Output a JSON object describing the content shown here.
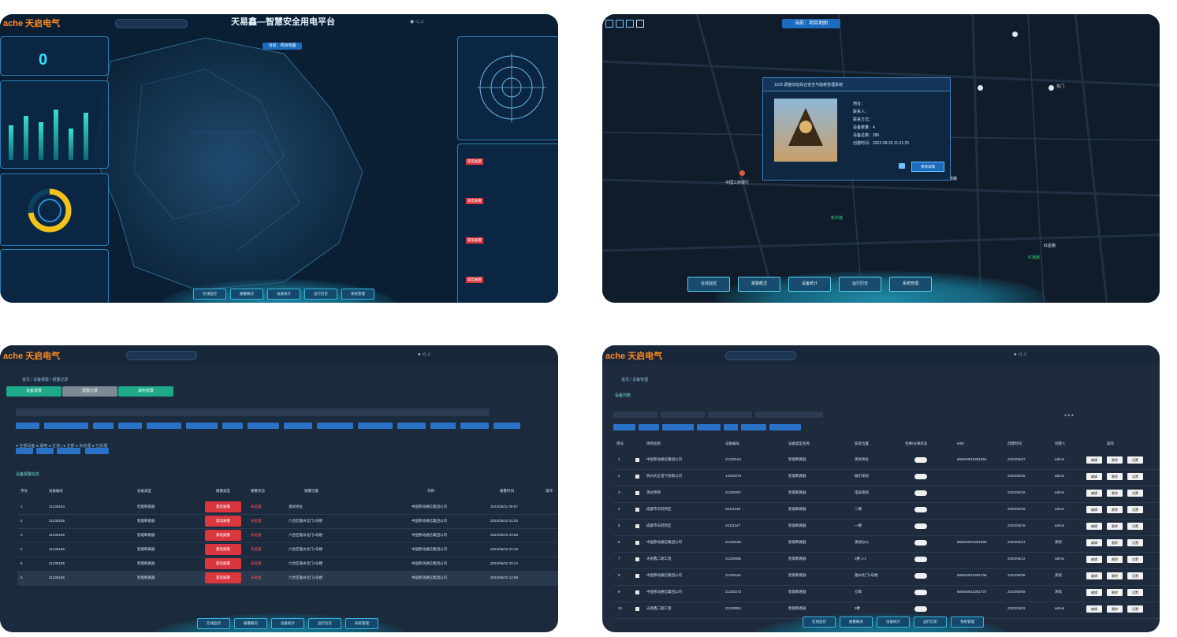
{
  "brand": "ache 天启电气",
  "panel1": {
    "title": "天易鑫—智慧安全用电平台",
    "current_tag": "当前：项目地图",
    "stat_value": "0",
    "alarm_labels": [
      "漏电报警",
      "漏电报警",
      "漏电报警",
      "漏电报警"
    ],
    "nav": [
      "在线监控",
      "报警概况",
      "设备统计",
      "运行历史",
      "系统管理"
    ],
    "bar_heights": [
      0.55,
      0.7,
      0.6,
      0.8,
      0.5,
      0.75
    ]
  },
  "panel2": {
    "current_tag": "当前：项目地图",
    "popup_title": "1103 调度旧址综合安全与能耗管理系统",
    "popup_lines": [
      "地址：",
      "联系人：",
      "联系方式：",
      "设备数量：4",
      "设备总数：285",
      "创建时间：2022-08-29 11:01:25"
    ],
    "popup_button": "项目详情",
    "places": [
      "中国工商银行",
      "红星路",
      "红旗路",
      "火车南路",
      "新华路",
      "东门"
    ],
    "nav": [
      "在线监控",
      "报警概况",
      "设备统计",
      "运行历史",
      "系统管理"
    ]
  },
  "panel3": {
    "breadcrumb": "首页 / 设备报警 / 报警记录",
    "tabs": [
      "设备报警",
      "报警记录",
      "漏电报警"
    ],
    "section_title": "设备报警信息",
    "headers": [
      "序号",
      "设备编号",
      "设备类型",
      "报警类型",
      "报警状态",
      "报警位置",
      "项目",
      "报警时间",
      "操作"
    ],
    "rows": [
      {
        "no": "1",
        "code": "21230164",
        "type": "智能断路器",
        "alarm": "漏电报警",
        "status": "未处理",
        "loc": "测试地址",
        "proj": "中国移动通信集团公司",
        "time": "2022/06/11 09:57"
      },
      {
        "no": "2",
        "code": "21230165",
        "type": "智能断路器",
        "alarm": "漏电报警",
        "status": "未处理",
        "loc": "六合区雄州北门1号楼",
        "proj": "中国移动通信集团公司",
        "time": "2022/06/10 21:02"
      },
      {
        "no": "3",
        "code": "21230165",
        "type": "智能断路器",
        "alarm": "漏电报警",
        "status": "未处理",
        "loc": "六合区雄州北门1号楼",
        "proj": "中国移动通信集团公司",
        "time": "2022/06/10 20:55"
      },
      {
        "no": "4",
        "code": "21230165",
        "type": "智能断路器",
        "alarm": "漏电报警",
        "status": "未处理",
        "loc": "六合区雄州北门1号楼",
        "proj": "中国移动通信集团公司",
        "time": "2022/06/10 20:49"
      },
      {
        "no": "5",
        "code": "21230165",
        "type": "智能断路器",
        "alarm": "漏电报警",
        "status": "未处理",
        "loc": "六合区雄州北门1号楼",
        "proj": "中国移动通信集团公司",
        "time": "2022/06/10 20:44"
      },
      {
        "no": "6",
        "code": "21230165",
        "type": "智能断路器",
        "alarm": "漏电报警",
        "status": "未处理",
        "loc": "六合区雄州北门1号楼",
        "proj": "中国移动通信集团公司",
        "time": "2022/06/10 12:58"
      }
    ],
    "nav": [
      "在线监控",
      "报警概况",
      "设备统计",
      "运行历史",
      "系统管理"
    ]
  },
  "panel4": {
    "breadcrumb": "首页 / 设备管理",
    "section_title": "设备列表",
    "headers": [
      "序号",
      "",
      "项目名称",
      "设备编号",
      "设备类型名称",
      "安装位置",
      "合闸/分闸状态",
      "IMEI",
      "创建时间",
      "创建人",
      "操作"
    ],
    "rows": [
      {
        "no": "1",
        "name": "中国移动通信集团公司",
        "code": "21230164",
        "type": "智能断路器",
        "loc": "测试地址",
        "imei": "866049010281654",
        "date": "2022/06/27",
        "user": "admin"
      },
      {
        "no": "2",
        "name": "杭州天正电气有限公司",
        "code": "14230079",
        "type": "智能断路器",
        "loc": "展示测试",
        "imei": "",
        "date": "2022/06/25",
        "user": "admin"
      },
      {
        "no": "3",
        "name": "测试项目",
        "code": "21230267",
        "type": "智能断路器",
        "loc": "电表测试",
        "imei": "",
        "date": "2022/06/18",
        "user": "admin"
      },
      {
        "no": "4",
        "name": "成都市天府新区",
        "code": "22111148",
        "type": "智能断路器",
        "loc": "二楼",
        "imei": "",
        "date": "2022/06/15",
        "user": "admin"
      },
      {
        "no": "5",
        "name": "成都市天府新区",
        "code": "22111147",
        "type": "智能断路器",
        "loc": "一楼",
        "imei": "",
        "date": "2022/06/15",
        "user": "admin"
      },
      {
        "no": "6",
        "name": "中国移动通信集团公司",
        "code": "21230195",
        "type": "智能断路器",
        "loc": "测试办公",
        "imei": "866049010281680",
        "date": "2022/06/13",
        "user": "测试"
      },
      {
        "no": "7",
        "name": "天易鑫二期工程",
        "code": "21230085",
        "type": "智能断路器",
        "loc": "3楼 3-1",
        "imei": "",
        "date": "2022/06/12",
        "user": "admin"
      },
      {
        "no": "8",
        "name": "中国移动通信集团公司",
        "code": "21230162",
        "type": "智能断路器",
        "loc": "雄州北门1号楼",
        "imei": "866049010281706",
        "date": "2022/06/08",
        "user": "测试"
      },
      {
        "no": "9",
        "name": "中国移动通信集团公司",
        "code": "21230273",
        "type": "智能断路器",
        "loc": "仓库",
        "imei": "866049010281707",
        "date": "2022/06/08",
        "user": "测试"
      },
      {
        "no": "10",
        "name": "天易鑫二期工程",
        "code": "21230084",
        "type": "智能断路器",
        "loc": "3楼",
        "imei": "",
        "date": "2022/06/02",
        "user": "admin"
      }
    ],
    "ops": [
      "编辑",
      "删除",
      "设置"
    ],
    "nav": [
      "在线监控",
      "报警概况",
      "设备统计",
      "运行历史",
      "系统管理"
    ]
  }
}
